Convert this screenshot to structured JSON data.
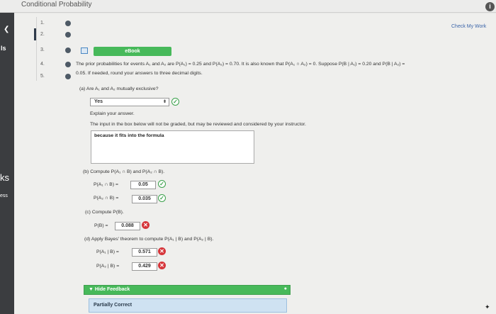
{
  "app": {
    "title": "Conditional Probability",
    "info_icon": "i"
  },
  "sidebar": {
    "chevron": "❮",
    "text_top": "ls",
    "text_mid": "ks",
    "text_bottom": "ess"
  },
  "question_nav": {
    "items": [
      {
        "number": "1."
      },
      {
        "number": "2."
      },
      {
        "number": "3."
      },
      {
        "number": "4."
      },
      {
        "number": "5."
      }
    ]
  },
  "header": {
    "check_my_work": "Check My Work",
    "ebook_label": "eBook"
  },
  "problem": {
    "line1": "The prior probabilities for events A₁ and A₂ are P(A₁) = 0.25 and P(A₂) = 0.70. It is also known that P(A₁ ∩ A₂) = 0. Suppose P(B | A₁) = 0.20 and P(B | A₂) =",
    "line2": "0.05. If needed, round your answers to three decimal digits."
  },
  "part_a": {
    "question": "(a) Are A₁ and A₂ mutually exclusive?",
    "selected": "Yes",
    "explain_label": "Explain your answer.",
    "note": "The input in the box below will not be graded, but may be reviewed and considered by your instructor.",
    "explanation": "because it fits into the formula"
  },
  "part_b": {
    "question": "(b) Compute P(A₁ ∩ B) and P(A₂ ∩ B).",
    "label1": "P(A₁ ∩ B) =",
    "value1": "0.05",
    "label2": "P(A₂ ∩ B) =",
    "value2": "0.035"
  },
  "part_c": {
    "question": "(c) Compute P(B).",
    "label": "P(B) =",
    "value": "0.088"
  },
  "part_d": {
    "question": "(d) Apply Bayes' theorem to compute P(A₁ | B) and P(A₂ | B).",
    "label1": "P(A₁ | B) =",
    "value1": "0.571",
    "label2": "P(A₂ | B) =",
    "value2": "0.429"
  },
  "feedback": {
    "toggle": "▼ Hide Feedback",
    "status": "Partially Correct"
  },
  "colors": {
    "accent_green": "#47b95a",
    "error_red": "#d6363b",
    "link_blue": "#3a64a8"
  }
}
